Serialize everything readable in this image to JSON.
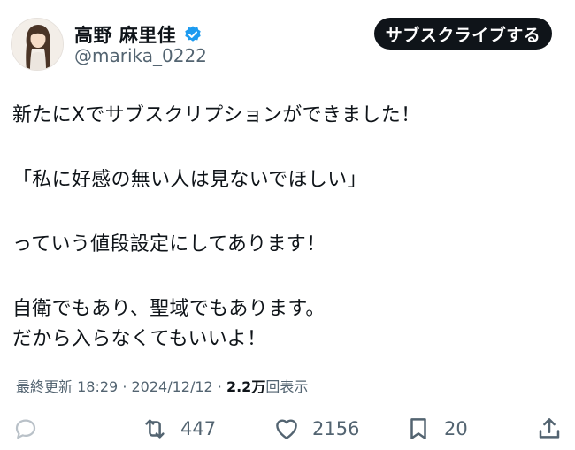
{
  "colors": {
    "text_primary": "#0f1419",
    "text_secondary": "#536471",
    "verified_badge": "#1d9bf0",
    "button_bg": "#0f1419",
    "button_text": "#ffffff"
  },
  "author": {
    "display_name": "高野 麻里佳",
    "handle": "@marika_0222",
    "verified": true,
    "verified_icon": "verified-badge-icon",
    "avatar": "profile-photo"
  },
  "header": {
    "subscribe_label": "サブスクライブする"
  },
  "tweet": {
    "lines": [
      "新たにXでサブスクリプションができました！",
      "「私に好感の無い人は見ないでほしい」",
      "っていう値段設定にしてあります！",
      "自衛でもあり、聖域でもあります。",
      "だから入らなくてもいいよ！"
    ]
  },
  "meta": {
    "updated_label": "最終更新",
    "time": "18:29",
    "date": "2024/12/12",
    "views_count": "2.2万",
    "views_label": "回表示"
  },
  "actions": {
    "reply": {
      "icon": "reply-icon",
      "count": ""
    },
    "retweet": {
      "icon": "retweet-icon",
      "count": "447"
    },
    "like": {
      "icon": "heart-icon",
      "count": "2156"
    },
    "bookmark": {
      "icon": "bookmark-icon",
      "count": "20"
    },
    "share": {
      "icon": "share-icon",
      "count": ""
    }
  }
}
